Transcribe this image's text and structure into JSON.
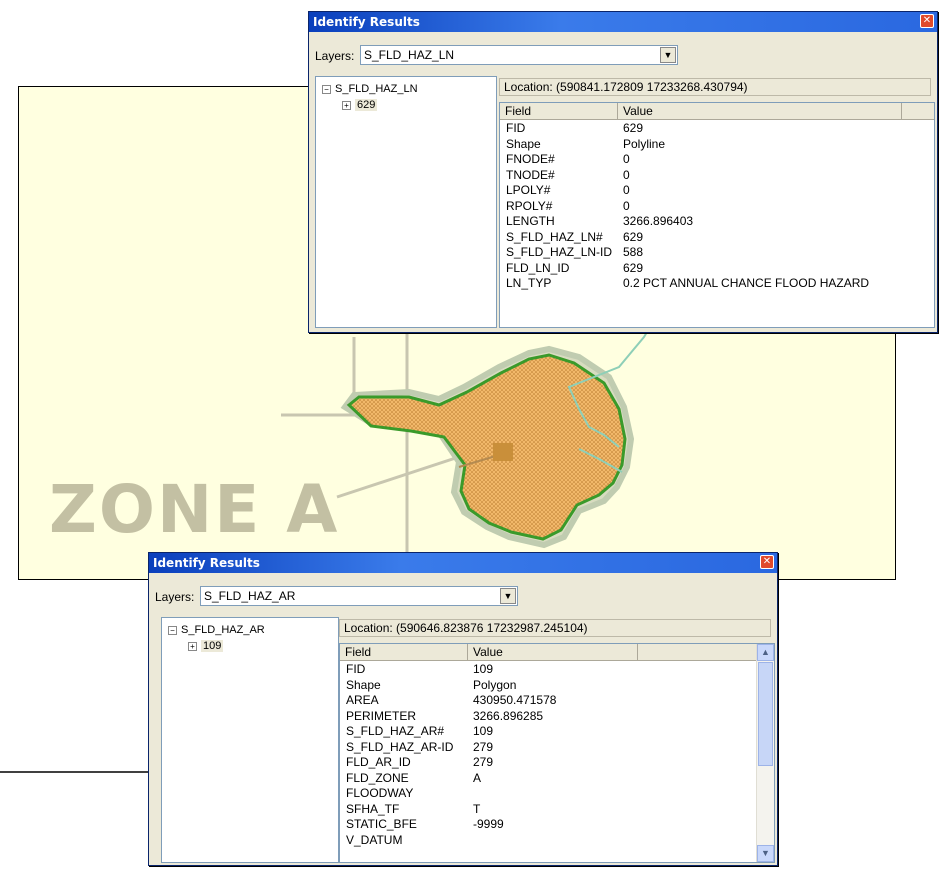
{
  "map": {
    "zone_label": "ZONE A",
    "colors": {
      "background": "#ffffe0",
      "polygon_fill": "#f0b060",
      "polygon_stroke": "#3a9a2a",
      "stream": "#8ecfb7",
      "roads": "#c8c6b0"
    }
  },
  "window_top": {
    "title": "Identify Results",
    "layers_label": "Layers:",
    "layer_value": "S_FLD_HAZ_LN",
    "tree_root": "S_FLD_HAZ_LN",
    "tree_child": "629",
    "location": "Location: (590841.172809 17233268.430794)",
    "col_field": "Field",
    "col_value": "Value",
    "rows": [
      {
        "field": "FID",
        "value": "629"
      },
      {
        "field": "Shape",
        "value": "Polyline"
      },
      {
        "field": "FNODE#",
        "value": "0"
      },
      {
        "field": "TNODE#",
        "value": "0"
      },
      {
        "field": "LPOLY#",
        "value": "0"
      },
      {
        "field": "RPOLY#",
        "value": "0"
      },
      {
        "field": "LENGTH",
        "value": "3266.896403"
      },
      {
        "field": "S_FLD_HAZ_LN#",
        "value": "629"
      },
      {
        "field": "S_FLD_HAZ_LN-ID",
        "value": "588"
      },
      {
        "field": "FLD_LN_ID",
        "value": "629"
      },
      {
        "field": "LN_TYP",
        "value": "0.2 PCT ANNUAL CHANCE FLOOD HAZARD"
      }
    ]
  },
  "window_bottom": {
    "title": "Identify Results",
    "layers_label": "Layers:",
    "layer_value": "S_FLD_HAZ_AR",
    "tree_root": "S_FLD_HAZ_AR",
    "tree_child": "109",
    "location": "Location: (590646.823876 17232987.245104)",
    "col_field": "Field",
    "col_value": "Value",
    "rows": [
      {
        "field": "FID",
        "value": "109"
      },
      {
        "field": "Shape",
        "value": "Polygon"
      },
      {
        "field": "AREA",
        "value": "430950.471578"
      },
      {
        "field": "PERIMETER",
        "value": "3266.896285"
      },
      {
        "field": "S_FLD_HAZ_AR#",
        "value": "109"
      },
      {
        "field": "S_FLD_HAZ_AR-ID",
        "value": "279"
      },
      {
        "field": "FLD_AR_ID",
        "value": "279"
      },
      {
        "field": "FLD_ZONE",
        "value": "A"
      },
      {
        "field": "FLOODWAY",
        "value": ""
      },
      {
        "field": "SFHA_TF",
        "value": "T"
      },
      {
        "field": "STATIC_BFE",
        "value": "-9999"
      },
      {
        "field": "V_DATUM",
        "value": ""
      }
    ]
  }
}
